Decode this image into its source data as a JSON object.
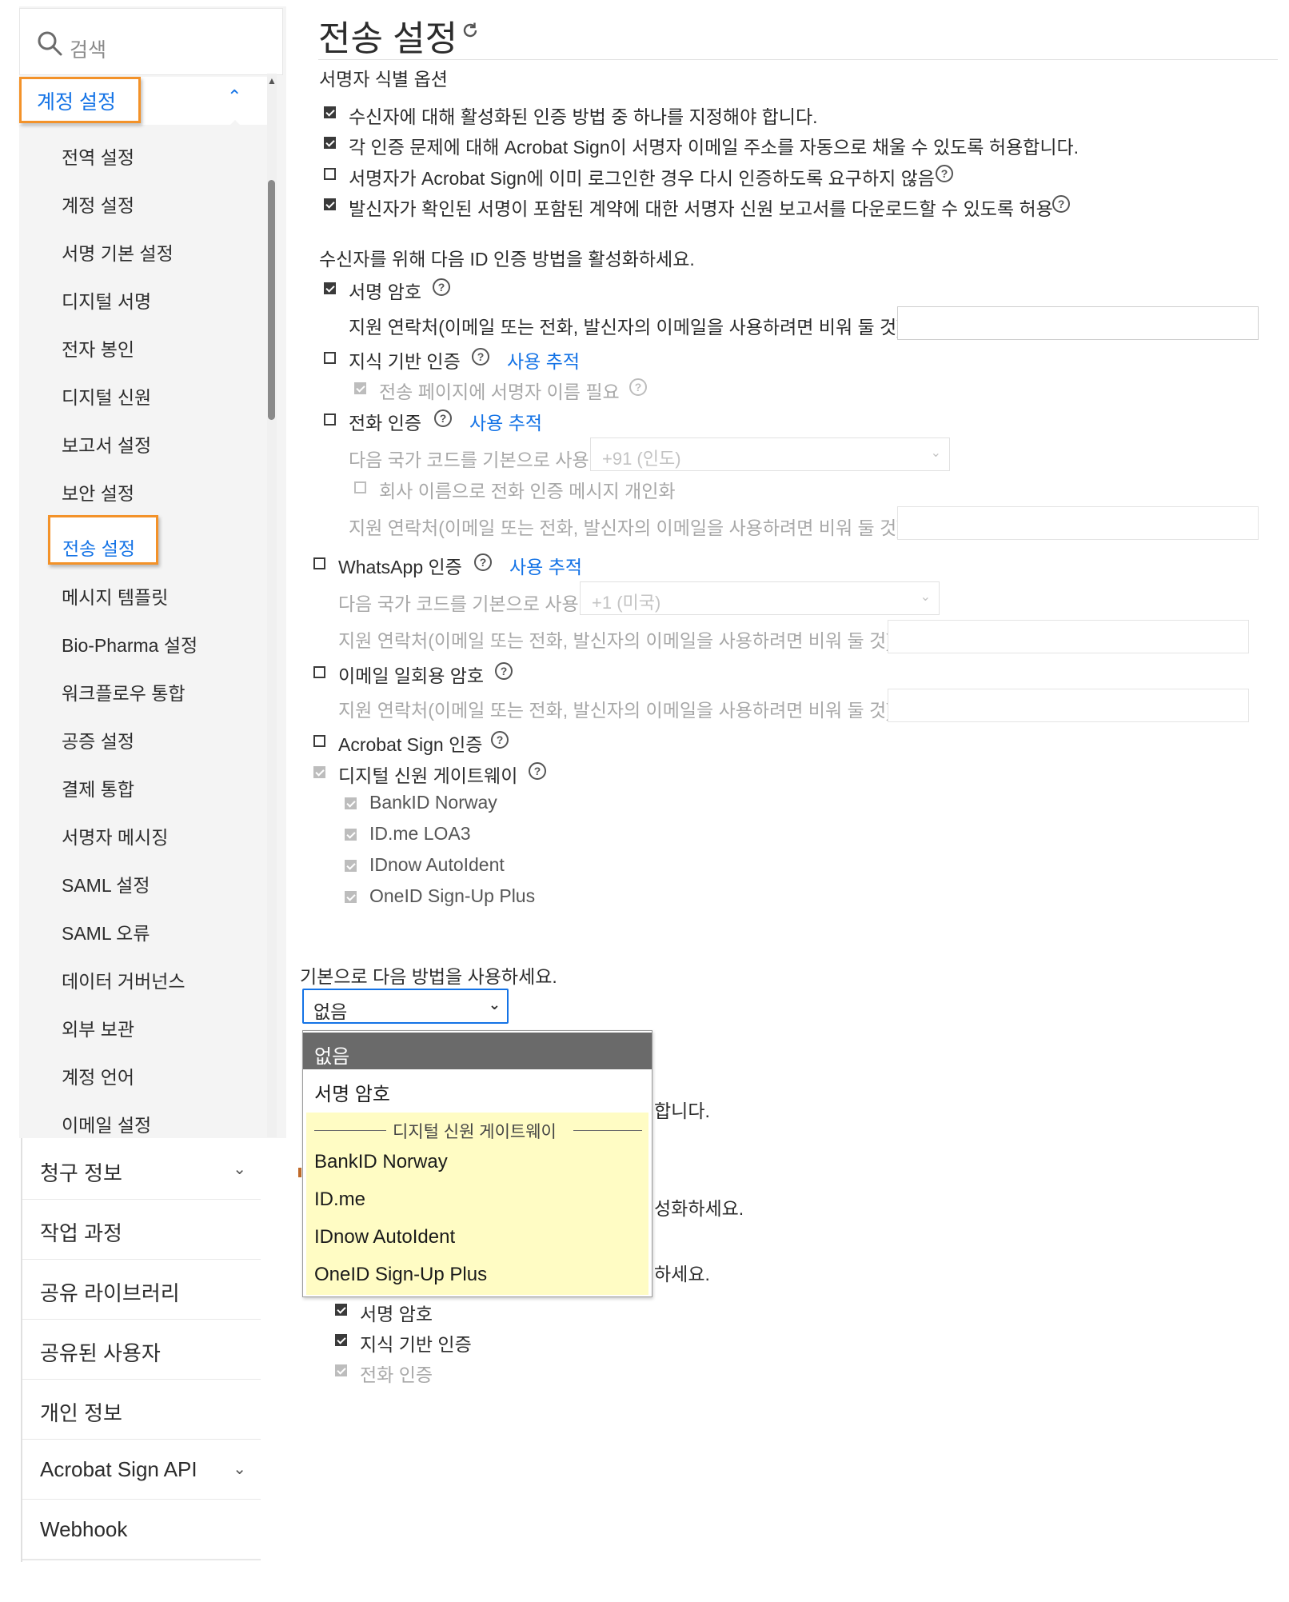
{
  "search": {
    "placeholder": "검색"
  },
  "sidebar": {
    "account_settings": "계정 설정",
    "sub_items": [
      "전역 설정",
      "계정 설정",
      "서명 기본 설정",
      "디지털 서명",
      "전자 봉인",
      "디지털 신원",
      "보고서 설정",
      "보안 설정",
      "전송 설정",
      "메시지 템플릿",
      "Bio-Pharma 설정",
      "워크플로우 통합",
      "공증 설정",
      "결제 통합",
      "서명자 메시징",
      "SAML 설정",
      "SAML 오류",
      "데이터 거버넌스",
      "외부 보관",
      "계정 언어",
      "이메일 설정"
    ],
    "active_item": "전송 설정",
    "nav": [
      {
        "label": "청구 정보",
        "expandable": true
      },
      {
        "label": "작업 과정",
        "expandable": false
      },
      {
        "label": "공유 라이브러리",
        "expandable": false
      },
      {
        "label": "공유된 사용자",
        "expandable": false
      },
      {
        "label": "개인 정보",
        "expandable": false
      },
      {
        "label": "Acrobat Sign API",
        "expandable": true
      },
      {
        "label": "Webhook",
        "expandable": false
      }
    ]
  },
  "page": {
    "title": "전송 설정"
  },
  "signer_options": {
    "heading": "서명자 식별 옵션",
    "items": [
      {
        "label": "수신자에 대해 활성화된 인증 방법 중 하나를 지정해야 합니다.",
        "checked": true
      },
      {
        "label": "각 인증 문제에 대해 Acrobat Sign이 서명자 이메일 주소를 자동으로 채울 수 있도록 허용합니다.",
        "checked": true
      },
      {
        "label": "서명자가 Acrobat Sign에 이미 로그인한 경우 다시 인증하도록 요구하지 않음",
        "checked": false
      },
      {
        "label": "발신자가 확인된 서명이 포함된 계약에 대한 서명자 신원 보고서를 다운로드할 수 있도록 허용",
        "checked": true
      }
    ]
  },
  "id_methods": {
    "heading": "수신자를 위해 다음 ID 인증 방법을 활성화하세요.",
    "password": "서명 암호",
    "password_contact": "지원 연락처(이메일 또는 전화, 발신자의 이메일을 사용하려면 비워 둘 것):",
    "kba": "지식 기반 인증",
    "kba_track": "사용 추적",
    "kba_require_name": "전송 페이지에 서명자 이름 필요",
    "phone": "전화 인증",
    "phone_track": "사용 추적",
    "phone_country_label": "다음 국가 코드를 기본으로 사용:",
    "phone_country_value": "+91 (인도)",
    "phone_personalize": "회사 이름으로 전화 인증 메시지 개인화",
    "phone_contact": "지원 연락처(이메일 또는 전화, 발신자의 이메일을 사용하려면 비워 둘 것):",
    "whatsapp": "WhatsApp 인증",
    "whatsapp_track": "사용 추적",
    "whatsapp_country_label": "다음 국가 코드를 기본으로 사용:",
    "whatsapp_country_value": "+1 (미국)",
    "whatsapp_contact": "지원 연락처(이메일 또는 전화, 발신자의 이메일을 사용하려면 비워 둘 것):",
    "email_otp": "이메일 일회용 암호",
    "email_otp_contact": "지원 연락처(이메일 또는 전화, 발신자의 이메일을 사용하려면 비워 둘 것):",
    "acrobat_sign": "Acrobat Sign 인증",
    "digital_identity": "디지털 신원 게이트웨이",
    "providers": [
      "BankID Norway",
      "ID.me LOA3",
      "IDnow AutoIdent",
      "OneID Sign-Up Plus"
    ]
  },
  "default_method": {
    "label": "기본으로 다음 방법을 사용하세요.",
    "value": "없음",
    "options": {
      "none": "없음",
      "password": "서명 암호",
      "group_label": "디지털 신원 게이트웨이",
      "group_items": [
        "BankID Norway",
        "ID.me",
        "IDnow AutoIdent",
        "OneID Sign-Up Plus"
      ]
    }
  },
  "behind_dropdown": {
    "frag1": "합니다.",
    "frag2": "성화하세요.",
    "frag3": "하세요.",
    "frag_pw": "서명 암호",
    "frag_kba": "지식 기반 인증",
    "frag_phone": "전화 인증"
  },
  "colors": {
    "accent": "#1473e6",
    "highlight_border": "#f39229",
    "dropdown_group_bg": "#fffcc4"
  }
}
